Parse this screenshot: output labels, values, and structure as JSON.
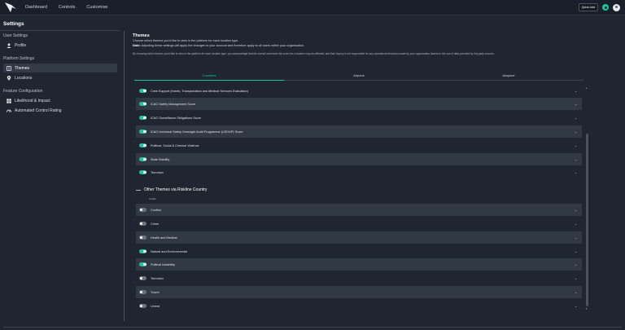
{
  "nav": {
    "items": [
      "Dashboard",
      "Controls",
      "Customise"
    ],
    "quick_button": "Quick Add"
  },
  "sidebar": {
    "title": "Settings",
    "sections": [
      {
        "label": "User Settings",
        "items": [
          {
            "label": "Profile",
            "icon": "person-icon"
          }
        ]
      },
      {
        "label": "Platform Settings",
        "items": [
          {
            "label": "Themes",
            "icon": "book-icon",
            "active": true
          },
          {
            "label": "Locations",
            "icon": "pin-icon"
          }
        ]
      },
      {
        "label": "Feature Configuration",
        "items": [
          {
            "label": "Likelihood & Impact",
            "icon": "grid-icon"
          },
          {
            "label": "Automated Control Rating",
            "icon": "gauge-icon"
          }
        ]
      }
    ]
  },
  "main": {
    "title": "Themes",
    "description": "Choose which themes you'd like to view in the platform for each location type.",
    "note_label": "Note:",
    "note_text": " Adjusting these settings will apply the changes to your account and therefore apply to all users within your organisation.",
    "disclaimer": "By choosing which themes you'd like to view in the platform for each location type, you acknowledge that the overall unrevised risk score for a location may be affected, and that Osprey is not responsible for any operational decisions made by your organisation based on the use of data provided by 3rd party sources.",
    "tabs": [
      {
        "label": "Countries",
        "active": true
      },
      {
        "label": "Airports",
        "active": false
      },
      {
        "label": "Airspace",
        "active": false
      }
    ],
    "themes": [
      {
        "label": "Crew Support (Hotels, Transportation and Medical Services Evaluation)",
        "on": true,
        "shaded": false
      },
      {
        "label": "ICAO Safety Management Score",
        "on": true,
        "shaded": true
      },
      {
        "label": "ICAO Surveillance Obligations Score",
        "on": true,
        "shaded": false
      },
      {
        "label": "ICAO Universal Safety Oversight Audit Programme (USOAP) Score",
        "on": true,
        "shaded": true
      },
      {
        "label": "Political, Social & Criminal Violence",
        "on": true,
        "shaded": false
      },
      {
        "label": "State Stability",
        "on": true,
        "shaded": true
      },
      {
        "label": "Terrorism",
        "on": true,
        "shaded": false
      }
    ],
    "other_title": "Other Themes via Riskline Country",
    "column_label": "Visible",
    "other_themes": [
      {
        "label": "Conflict",
        "on": false,
        "shaded": true
      },
      {
        "label": "Crime",
        "on": false,
        "shaded": false
      },
      {
        "label": "Health and Medical",
        "on": false,
        "shaded": true
      },
      {
        "label": "Natural and Environmental",
        "on": true,
        "shaded": false
      },
      {
        "label": "Political Instability",
        "on": true,
        "shaded": true
      },
      {
        "label": "Terrorism",
        "on": false,
        "shaded": false
      },
      {
        "label": "Travel",
        "on": false,
        "shaded": true
      },
      {
        "label": "Unrest",
        "on": false,
        "shaded": false
      }
    ]
  },
  "colors": {
    "accent": "#20c4a0",
    "background": "#1f2630",
    "row_shade": "#313945"
  }
}
